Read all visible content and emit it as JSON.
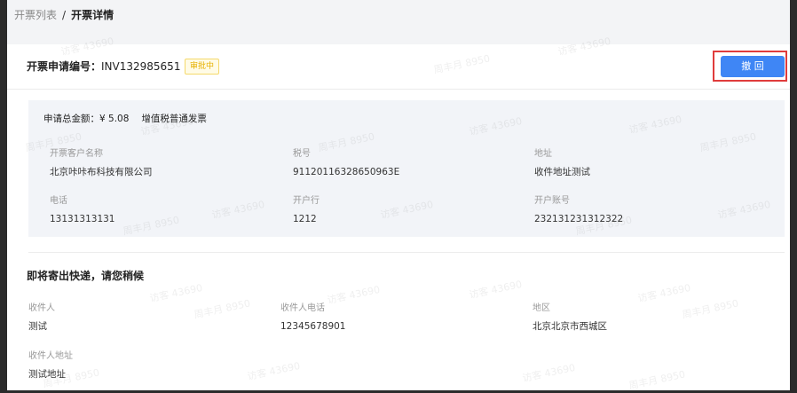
{
  "breadcrumb": {
    "parent": "开票列表",
    "separator": "/",
    "current": "开票详情"
  },
  "header": {
    "application_label": "开票申请编号：",
    "application_no": "INV132985651",
    "status": "审批中",
    "withdraw_label": "撤 回"
  },
  "invoice": {
    "total_label": "申请总金额：",
    "total_value": "¥ 5.08",
    "invoice_type": "增值税普通发票",
    "fields": [
      {
        "label": "开票客户名称",
        "value": "北京咔咔布科技有限公司"
      },
      {
        "label": "税号",
        "value": "91120116328650963E"
      },
      {
        "label": "地址",
        "value": "收件地址测试"
      },
      {
        "label": "电话",
        "value": "13131313131"
      },
      {
        "label": "开户行",
        "value": "1212"
      },
      {
        "label": "开户账号",
        "value": "232131231312322"
      }
    ]
  },
  "shipping": {
    "title": "即将寄出快递，请您稍候",
    "fields": [
      {
        "label": "收件人",
        "value": "测试"
      },
      {
        "label": "收件人电话",
        "value": "12345678901"
      },
      {
        "label": "地区",
        "value": "北京北京市西城区"
      },
      {
        "label": "收件人地址",
        "value": "测试地址"
      }
    ]
  },
  "watermarks": {
    "a": "访客 43690",
    "b": "周丰月 8950"
  },
  "colors": {
    "primary": "#3f86f5",
    "highlight": "#e03c3c",
    "pending": "#e6b000"
  }
}
